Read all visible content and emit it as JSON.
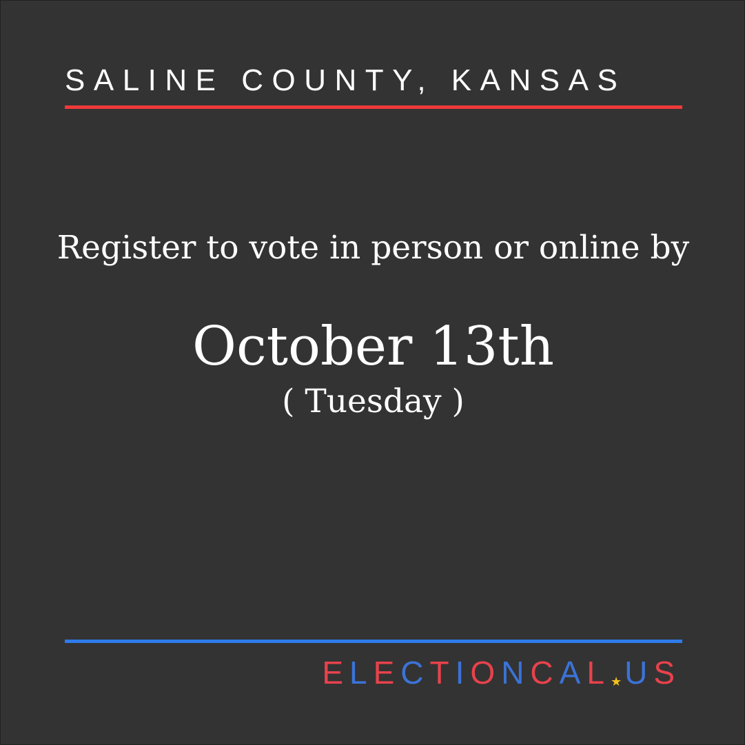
{
  "location": "SALINE COUNTY, KANSAS",
  "message": "Register to vote in person or online by",
  "deadline": {
    "date": "October 13th",
    "weekday": "( Tuesday )"
  },
  "brand": {
    "part1": "ELECTIONCAL",
    "separator_icon": "star-icon",
    "separator_glyph": "★",
    "part2": "US"
  },
  "colors": {
    "background": "#333333",
    "text": "#ffffff",
    "accent_red": "#ef3a3a",
    "accent_blue": "#2e7bea",
    "brand_red": "#e8424c",
    "brand_blue": "#3b73d8",
    "star_yellow": "#f4c21b"
  }
}
